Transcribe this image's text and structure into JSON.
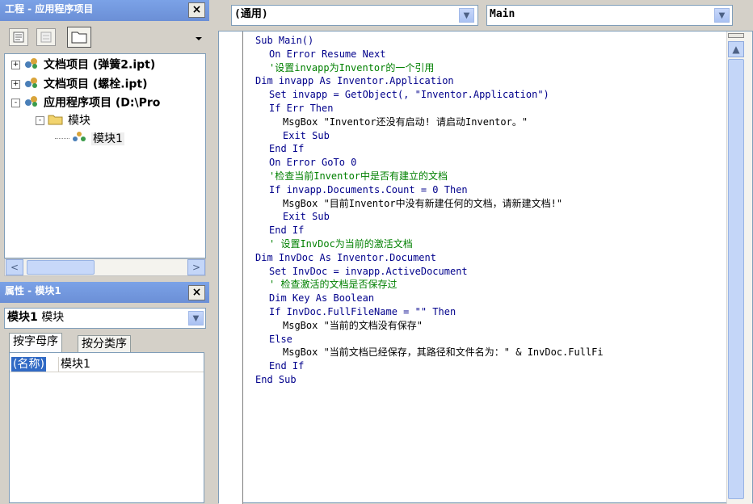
{
  "project_pane": {
    "title": "工程 - 应用程序项目",
    "close_label": "×",
    "tree": [
      {
        "label": "文档项目  (弹簧2.ipt)",
        "level": 0,
        "expander": "+",
        "bold": true
      },
      {
        "label": "文档项目  (螺栓.ipt)",
        "level": 0,
        "expander": "+",
        "bold": true
      },
      {
        "label": "应用程序项目  (D:\\Pro",
        "level": 0,
        "expander": "-",
        "bold": true
      },
      {
        "label": "模块",
        "level": 1,
        "expander": "-",
        "bold": false
      },
      {
        "label": "模块1",
        "level": 2,
        "expander": "",
        "bold": false
      }
    ],
    "scroll_left": "<",
    "scroll_right": ">"
  },
  "properties_pane": {
    "title": "属性 - 模块1",
    "close_label": "×",
    "object_bold": "模块1",
    "object_type": "模块",
    "tabs": [
      "按字母序",
      "按分类序"
    ],
    "grid_rows": [
      {
        "name": "(名称)",
        "value": "模块1"
      }
    ]
  },
  "code_window": {
    "object_combo": "(通用)",
    "proc_combo": "Main",
    "lines": [
      {
        "indent": 0,
        "parts": [
          {
            "t": "Sub Main()",
            "c": "kw"
          }
        ]
      },
      {
        "indent": 2,
        "parts": [
          {
            "t": "On Error Resume Next",
            "c": "kw"
          }
        ]
      },
      {
        "indent": 2,
        "parts": [
          {
            "t": "'设置invapp为Inventor的一个引用",
            "c": "cm"
          }
        ]
      },
      {
        "indent": 0,
        "parts": [
          {
            "t": "Dim invapp As Inventor.Application",
            "c": "kw"
          }
        ]
      },
      {
        "indent": 2,
        "parts": [
          {
            "t": "Set invapp = GetObject(, \"Inventor.Application\")",
            "c": "kw"
          }
        ]
      },
      {
        "indent": 2,
        "parts": [
          {
            "t": "If Err Then",
            "c": "kw"
          }
        ]
      },
      {
        "indent": 4,
        "parts": [
          {
            "t": "MsgBox \"Inventor还没有启动! 请启动Inventor。\"",
            "c": "tx"
          }
        ]
      },
      {
        "indent": 4,
        "parts": [
          {
            "t": "Exit Sub",
            "c": "kw"
          }
        ]
      },
      {
        "indent": 2,
        "parts": [
          {
            "t": "End If",
            "c": "kw"
          }
        ]
      },
      {
        "indent": 2,
        "parts": [
          {
            "t": "On Error GoTo 0",
            "c": "kw"
          }
        ]
      },
      {
        "indent": 2,
        "parts": [
          {
            "t": "'检查当前Inventor中是否有建立的文档",
            "c": "cm"
          }
        ]
      },
      {
        "indent": 2,
        "parts": [
          {
            "t": "If invapp.Documents.Count = 0 Then",
            "c": "kw"
          }
        ]
      },
      {
        "indent": 4,
        "parts": [
          {
            "t": "MsgBox \"目前Inventor中没有新建任何的文档，请新建文档!\"",
            "c": "tx"
          }
        ]
      },
      {
        "indent": 4,
        "parts": [
          {
            "t": "Exit Sub",
            "c": "kw"
          }
        ]
      },
      {
        "indent": 2,
        "parts": [
          {
            "t": "End If",
            "c": "kw"
          }
        ]
      },
      {
        "indent": 2,
        "parts": [
          {
            "t": "' 设置InvDoc为当前的激活文档",
            "c": "cm"
          }
        ]
      },
      {
        "indent": 0,
        "parts": [
          {
            "t": "Dim InvDoc As Inventor.Document",
            "c": "kw"
          }
        ]
      },
      {
        "indent": 2,
        "parts": [
          {
            "t": "Set InvDoc = invapp.ActiveDocument",
            "c": "kw"
          }
        ]
      },
      {
        "indent": 2,
        "parts": [
          {
            "t": "' 检查激活的文档是否保存过",
            "c": "cm"
          }
        ]
      },
      {
        "indent": 2,
        "parts": [
          {
            "t": "Dim Key As Boolean",
            "c": "kw"
          }
        ]
      },
      {
        "indent": 2,
        "parts": [
          {
            "t": "If InvDoc.FullFileName = \"\" Then",
            "c": "kw"
          }
        ]
      },
      {
        "indent": 4,
        "parts": [
          {
            "t": "MsgBox \"当前的文档没有保存\"",
            "c": "tx"
          }
        ]
      },
      {
        "indent": 2,
        "parts": [
          {
            "t": "Else",
            "c": "kw"
          }
        ]
      },
      {
        "indent": 4,
        "parts": [
          {
            "t": "MsgBox \"当前文档已经保存，其路径和文件名为：\" & InvDoc.FullFi",
            "c": "tx"
          }
        ]
      },
      {
        "indent": 2,
        "parts": [
          {
            "t": "End If",
            "c": "kw"
          }
        ]
      },
      {
        "indent": 0,
        "parts": [
          {
            "t": "End Sub",
            "c": "kw"
          }
        ]
      }
    ]
  },
  "colors": {
    "keyword": "#00008b",
    "comment": "#008000",
    "text": "#000000",
    "title_bar": "#7ba2e7"
  },
  "icons": [
    "view-code-icon",
    "view-object-icon",
    "toggle-folders-icon",
    "project-icon",
    "folder-icon",
    "module-icon"
  ]
}
